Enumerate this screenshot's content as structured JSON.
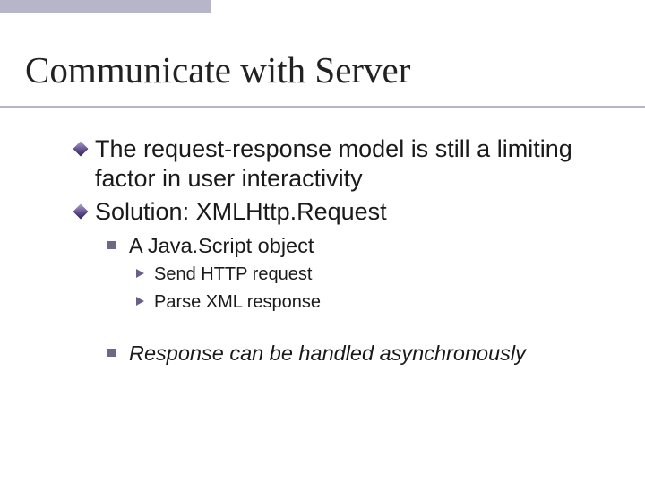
{
  "title": "Communicate with Server",
  "bullets": {
    "p1": "The request-response model is still a limiting factor in user interactivity",
    "p2": "Solution: XMLHttp.Request",
    "s1": "A Java.Script object",
    "t1": "Send HTTP request",
    "t2": "Parse XML response",
    "s2": "Response can be handled asynchronously"
  }
}
